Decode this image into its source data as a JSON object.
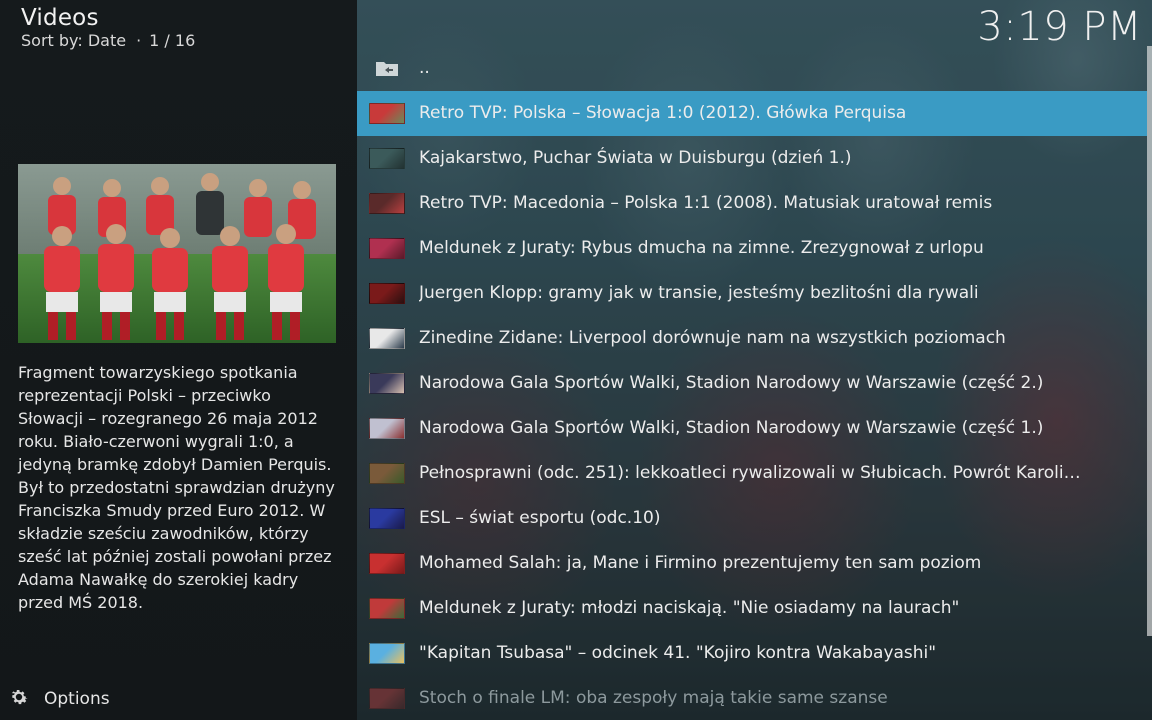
{
  "header": {
    "title": "Videos",
    "sort_label": "Sort by: Date",
    "position": "1 / 16",
    "clock": "3:19 PM"
  },
  "details": {
    "plot": "Fragment towarzyskiego spotkania reprezentacji Polski – przeciwko Słowacji – rozegranego 26 maja 2012 roku. Biało-czerwoni wygrali 1:0, a jedyną bramkę zdobył Damien Perquis. Był to przedostatni sprawdzian drużyny Franciszka Smudy przed Euro 2012. W składzie sześciu zawodników, którzy sześć lat później zostali powołani przez Adama Nawałkę do szerokiej kadry przed MŚ 2018."
  },
  "footer": {
    "options_label": "Options",
    "options_icon": "gear-icon"
  },
  "list": {
    "items": [
      {
        "label": "..",
        "icon": "folder-back-icon",
        "colors": [
          "#cfd6d8",
          "#9aa4a6"
        ]
      },
      {
        "label": "Retro TVP: Polska – Słowacja 1:0 (2012). Główka Perquisa",
        "icon": "video-thumbnail-icon",
        "colors": [
          "#c83a3a",
          "#6a8a5a"
        ]
      },
      {
        "label": "Kajakarstwo, Puchar Świata w Duisburgu (dzień 1.)",
        "icon": "video-thumbnail-icon",
        "colors": [
          "#3b5a5a",
          "#223232"
        ]
      },
      {
        "label": "Retro TVP:  Macedonia – Polska 1:1 (2008). Matusiak uratował remis",
        "icon": "video-thumbnail-icon",
        "colors": [
          "#5a2a2a",
          "#b84040"
        ]
      },
      {
        "label": "Meldunek z Juraty: Rybus dmucha na zimne. Zrezygnował z urlopu",
        "icon": "video-thumbnail-icon",
        "colors": [
          "#b03050",
          "#5a1a2a"
        ]
      },
      {
        "label": "Juergen Klopp: gramy jak w transie, jesteśmy bezlitośni dla rywali",
        "icon": "video-thumbnail-icon",
        "colors": [
          "#7a1a1a",
          "#2a1010"
        ]
      },
      {
        "label": "Zinedine Zidane: Liverpool dorównuje nam na wszystkich poziomach",
        "icon": "video-thumbnail-icon",
        "colors": [
          "#e8e8e8",
          "#2a3a4a"
        ]
      },
      {
        "label": "Narodowa Gala Sportów Walki, Stadion Narodowy w Warszawie (część 2.)",
        "icon": "video-thumbnail-icon",
        "colors": [
          "#3a3a5a",
          "#d8c0b0"
        ]
      },
      {
        "label": "Narodowa Gala Sportów Walki, Stadion Narodowy w Warszawie (część 1.)",
        "icon": "video-thumbnail-icon",
        "colors": [
          "#c0c0d0",
          "#8a3030"
        ]
      },
      {
        "label": "Pełnosprawni (odc. 251): lekkoatleci rywalizowali w Słubicach. Powrót Karolin...",
        "icon": "video-thumbnail-icon",
        "colors": [
          "#7a5a3a",
          "#3a5a2a"
        ]
      },
      {
        "label": "ESL – świat esportu (odc.10)",
        "icon": "video-thumbnail-icon",
        "colors": [
          "#2a3aa0",
          "#1a1a4a"
        ]
      },
      {
        "label": "Mohamed Salah:  ja, Mane i Firmino prezentujemy ten sam poziom",
        "icon": "video-thumbnail-icon",
        "colors": [
          "#c83030",
          "#7a1a1a"
        ]
      },
      {
        "label": "Meldunek z Juraty: młodzi naciskają. \"Nie osiadamy na laurach\"",
        "icon": "video-thumbnail-icon",
        "colors": [
          "#c03a3a",
          "#3a6a3a"
        ]
      },
      {
        "label": "\"Kapitan Tsubasa\" – odcinek 41. \"Kojiro kontra Wakabayashi\"",
        "icon": "video-thumbnail-icon",
        "colors": [
          "#5ab0e0",
          "#e8c060"
        ]
      },
      {
        "label": "Stoch o finale LM: oba zespoły mają takie same szanse",
        "icon": "video-thumbnail-icon",
        "colors": [
          "#c04040",
          "#5a2a2a"
        ]
      }
    ]
  },
  "colors": {
    "selection": "#3a9bc4"
  }
}
